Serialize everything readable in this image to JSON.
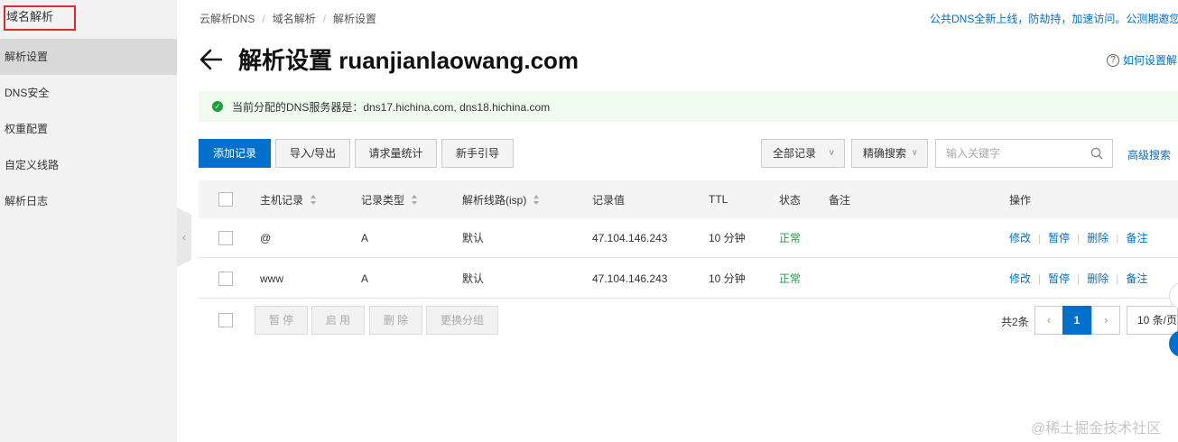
{
  "sidebar": {
    "title": "域名解析",
    "items": [
      {
        "label": "解析设置",
        "active": true
      },
      {
        "label": "DNS安全",
        "active": false
      },
      {
        "label": "权重配置",
        "active": false
      },
      {
        "label": "自定义线路",
        "active": false
      },
      {
        "label": "解析日志",
        "active": false
      }
    ],
    "collapse_glyph": "‹"
  },
  "breadcrumb": [
    "云解析DNS",
    "域名解析",
    "解析设置"
  ],
  "breadcrumb_sep": "/",
  "promo": "公共DNS全新上线，防劫持，加速访问。公测期邀您",
  "page": {
    "title": "解析设置 ruanjianlaowang.com",
    "help": "如何设置解"
  },
  "notice": {
    "text": "当前分配的DNS服务器是：dns17.hichina.com, dns18.hichina.com",
    "color": "#1d9e3a"
  },
  "toolbar": {
    "add": "添加记录",
    "import_export": "导入/导出",
    "query_stats": "请求量统计",
    "guide": "新手引导",
    "filter": "全部记录",
    "search_mode": "精确搜索",
    "search_placeholder": "输入关键字",
    "advanced": "高级搜索"
  },
  "table": {
    "headers": {
      "host": "主机记录",
      "type": "记录类型",
      "line": "解析线路(isp)",
      "value": "记录值",
      "ttl": "TTL",
      "status": "状态",
      "remark": "备注",
      "ops": "操作"
    },
    "rows": [
      {
        "host": "@",
        "type": "A",
        "line": "默认",
        "value": "47.104.146.243",
        "ttl": "10 分钟",
        "status": "正常",
        "remark": ""
      },
      {
        "host": "www",
        "type": "A",
        "line": "默认",
        "value": "47.104.146.243",
        "ttl": "10 分钟",
        "status": "正常",
        "remark": ""
      }
    ],
    "ops": {
      "edit": "修改",
      "pause": "暂停",
      "delete": "删除",
      "remark": "备注"
    },
    "ops_sep": "|"
  },
  "footer": {
    "pause": "暂 停",
    "enable": "启 用",
    "delete": "删 除",
    "change_group": "更换分组",
    "total": "共2条",
    "prev": "‹",
    "current_page": "1",
    "next": "›",
    "page_size": "10 条/页"
  },
  "watermark": "@稀土掘金技术社区",
  "colors": {
    "accent": "#0070cc",
    "success": "#1d9e3a",
    "notice_bg": "#effbee"
  }
}
